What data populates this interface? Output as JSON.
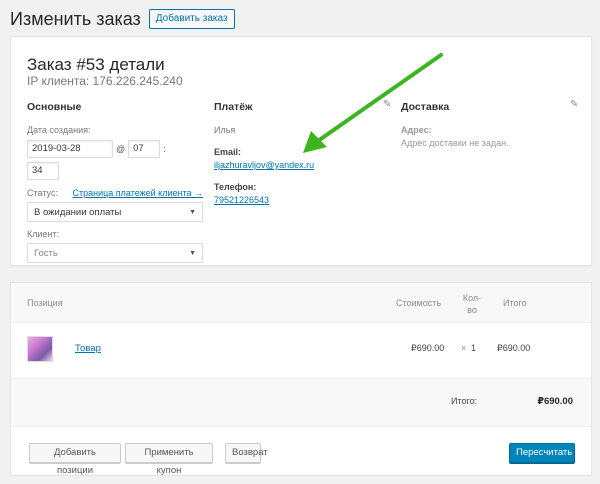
{
  "header": {
    "title": "Изменить заказ",
    "add_order_label": "Добавить заказ"
  },
  "order": {
    "heading": "Заказ #53 детали",
    "ip": "IP клиента: 176.226.245.240"
  },
  "general": {
    "title": "Основные",
    "date_label": "Дата создания:",
    "date_value": "2019-03-28",
    "at": "@",
    "hour_value": "07",
    "colon": ":",
    "minute_value": "34",
    "status_label": "Статус:",
    "status_link": "Страница платежей клиента →",
    "status_value": "В ожидании оплаты",
    "client_label": "Клиент:",
    "client_value": "Гость"
  },
  "payment": {
    "title": "Платёж",
    "name": "Илья",
    "email_label": "Email:",
    "email": "iljazhuravljov@yandex.ru",
    "phone_label": "Телефон:",
    "phone": "79521226543"
  },
  "shipping": {
    "title": "Доставка",
    "address_label": "Адрес:",
    "address_value": "Адрес доставки не задан."
  },
  "items": {
    "columns": {
      "position": "Позиция",
      "cost": "Стоимость",
      "qty": "Кол-во",
      "total": "Итого"
    },
    "rows": [
      {
        "name": "Товар",
        "cost": "₽690.00",
        "times": "×",
        "qty": "1",
        "total": "₽690.00"
      }
    ],
    "total_label": "Итого:",
    "total_value": "₽690.00"
  },
  "actions": {
    "add_items": "Добавить позиции",
    "apply_coupon": "Применить купон",
    "refund": "Возврат",
    "recalculate": "Пересчитать"
  },
  "icons": {
    "pencil": "pencil-icon",
    "dropdown": "chevron-down-icon",
    "annotation": "arrow-icon"
  },
  "colors": {
    "link": "#0073aa",
    "primary_button": "#0085ba",
    "annotation_arrow": "#3cb521"
  }
}
